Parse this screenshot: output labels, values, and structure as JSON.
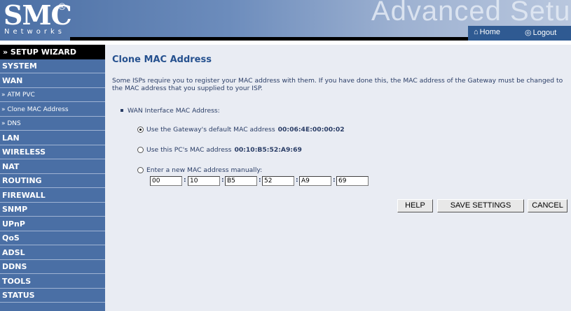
{
  "header": {
    "logo": "SMC",
    "logo_reg": "®",
    "logo_sub": "Networks",
    "title": "Advanced Setup",
    "home_icon": "home-icon",
    "home_label": "Home",
    "logout_icon": "logout-icon",
    "logout_label": "Logout"
  },
  "sidebar": {
    "wizard": "» SETUP WIZARD",
    "items": [
      {
        "label": "SYSTEM",
        "type": "main"
      },
      {
        "label": "WAN",
        "type": "main"
      },
      {
        "label": "» ATM PVC",
        "type": "sub"
      },
      {
        "label": "» Clone MAC Address",
        "type": "sub"
      },
      {
        "label": "» DNS",
        "type": "sub"
      },
      {
        "label": "LAN",
        "type": "main"
      },
      {
        "label": "WIRELESS",
        "type": "main"
      },
      {
        "label": "NAT",
        "type": "main"
      },
      {
        "label": "ROUTING",
        "type": "main"
      },
      {
        "label": "FIREWALL",
        "type": "main"
      },
      {
        "label": "SNMP",
        "type": "main"
      },
      {
        "label": "UPnP",
        "type": "main"
      },
      {
        "label": "QoS",
        "type": "main"
      },
      {
        "label": "ADSL",
        "type": "main"
      },
      {
        "label": "DDNS",
        "type": "main"
      },
      {
        "label": "TOOLS",
        "type": "main"
      },
      {
        "label": "STATUS",
        "type": "main"
      }
    ]
  },
  "main": {
    "title": "Clone MAC Address",
    "description": "Some ISPs require you to register your MAC address with them. If you have done this, the MAC address of the Gateway must be changed to the MAC address that you supplied to your ISP.",
    "section_label": "WAN Interface MAC Address:",
    "options": {
      "default_label": "Use the Gateway's default MAC address",
      "default_mac": "00:06:4E:00:00:02",
      "pc_label": "Use this PC's MAC address",
      "pc_mac": "00:10:B5:52:A9:69",
      "manual_label": "Enter a new MAC address manually:",
      "selected": "default"
    },
    "mac_fields": [
      "00",
      "10",
      "B5",
      "52",
      "A9",
      "69"
    ],
    "mac_separator": ":",
    "buttons": {
      "help": "HELP",
      "save": "SAVE SETTINGS",
      "cancel": "CANCEL"
    }
  },
  "colors": {
    "sidebar_bg": "#4a6fa5",
    "content_bg": "#e9ecf3",
    "title_color": "#26518f",
    "text_color": "#2a3d66"
  }
}
